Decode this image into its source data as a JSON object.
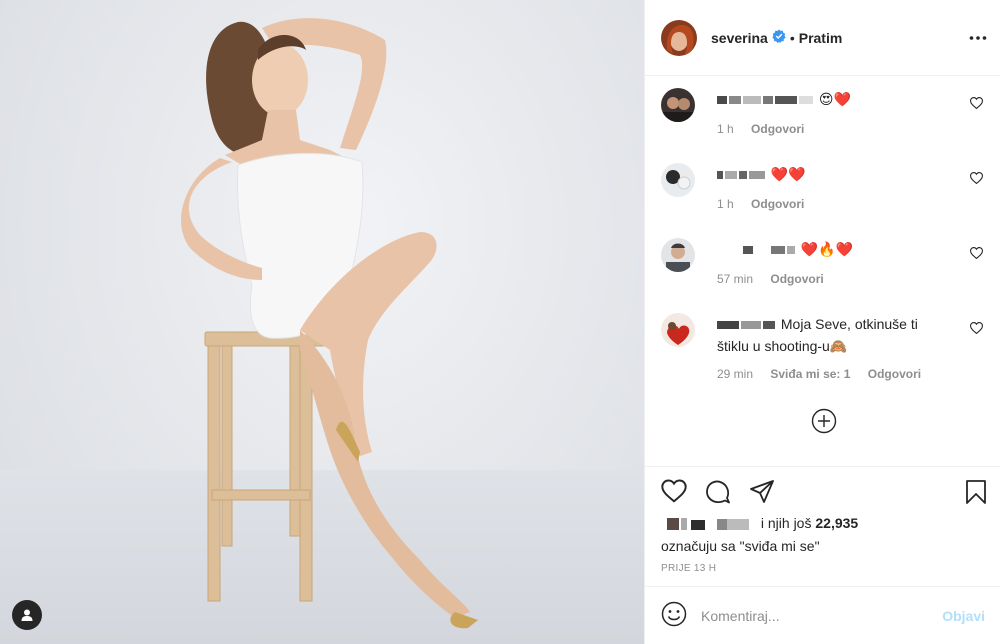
{
  "post": {
    "author": "severina",
    "follow_label": "Pratim",
    "separator": "•",
    "verified_icon": "verified-badge-icon",
    "photo_alt": "severina"
  },
  "comments": [
    {
      "text_suffix": "😍❤️",
      "time": "1 h",
      "reply": "Odgovori",
      "likes": ""
    },
    {
      "text_suffix": "❤️❤️",
      "time": "1 h",
      "reply": "Odgovori",
      "likes": ""
    },
    {
      "text_suffix": "❤️🔥❤️",
      "time": "57 min",
      "reply": "Odgovori",
      "likes": ""
    },
    {
      "text_suffix": "Moja Seve, otkinuše ti štiklu u shooting-u🙈",
      "time": "29 min",
      "reply": "Odgovori",
      "likes": "Sviđa mi se: 1"
    }
  ],
  "likes": {
    "prefix": "i njih još",
    "count": "22,935",
    "suffix": "označuju sa \"sviđa mi se\""
  },
  "timestamp": "PRIJE 13 H",
  "composer": {
    "placeholder": "Komentiraj...",
    "post_label": "Objavi"
  }
}
